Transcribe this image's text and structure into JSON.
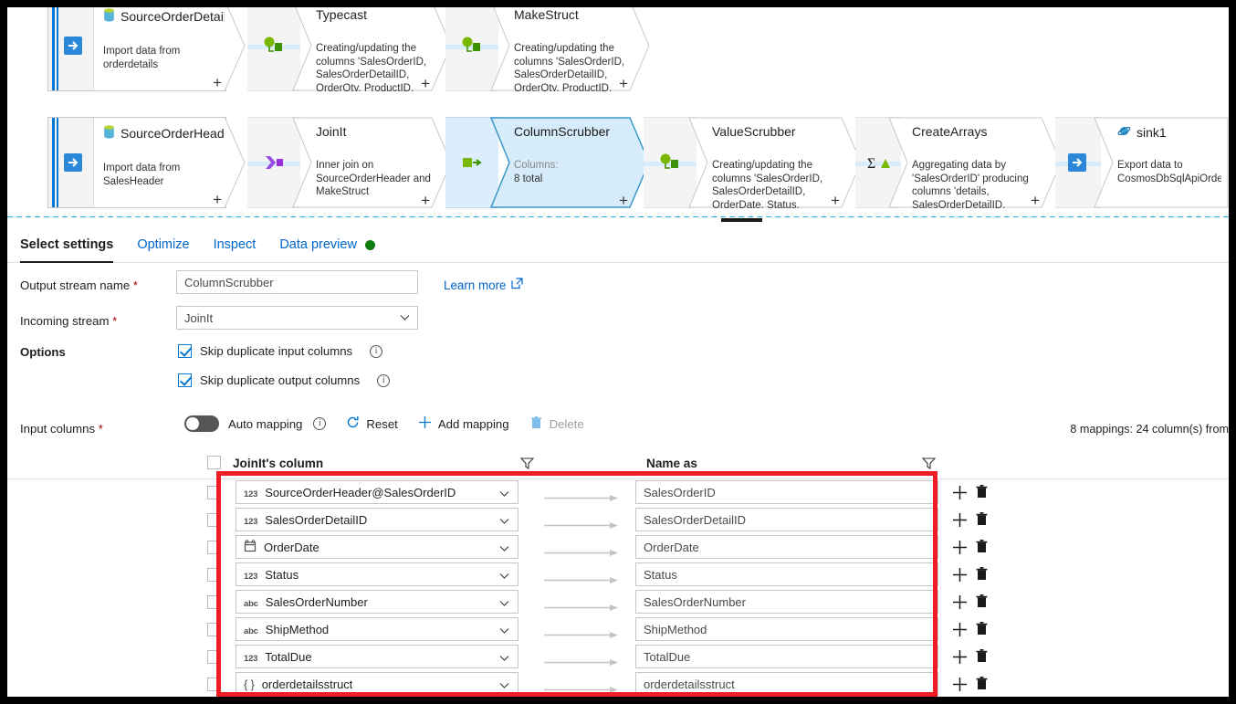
{
  "canvas": {
    "row1": [
      {
        "kind": "source",
        "icon": "sql-database-icon",
        "title": "SourceOrderDetails",
        "subtitle": "Import data from orderdetails",
        "plus": "+"
      },
      {
        "kind": "transform",
        "icon": "derived-column-icon",
        "title": "Typecast",
        "subtitle": "Creating/updating the columns 'SalesOrderID, SalesOrderDetailID, OrderQty, ProductID, UnitPrice,",
        "plus": "+"
      },
      {
        "kind": "transform",
        "icon": "derived-column-icon",
        "title": "MakeStruct",
        "subtitle": "Creating/updating the columns 'SalesOrderID, SalesOrderDetailID, OrderQty, ProductID, UnitPrice,",
        "plus": "+"
      }
    ],
    "row2": [
      {
        "kind": "source",
        "icon": "sql-database-icon",
        "title": "SourceOrderHeader",
        "subtitle": "Import data from SalesHeader",
        "plus": "+"
      },
      {
        "kind": "transform",
        "icon": "join-icon",
        "title": "JoinIt",
        "subtitle": "Inner join on SourceOrderHeader and MakeStruct",
        "plus": "+"
      },
      {
        "kind": "transform",
        "icon": "select-icon",
        "title": "ColumnScrubber",
        "subtitle_label": "Columns:",
        "subtitle": "8 total",
        "plus": "+",
        "selected": true
      },
      {
        "kind": "transform",
        "icon": "derived-column-icon",
        "title": "ValueScrubber",
        "subtitle": "Creating/updating the columns 'SalesOrderID, SalesOrderDetailID, OrderDate, Status, SalesOrderNumber,",
        "plus": "+"
      },
      {
        "kind": "transform",
        "icon": "aggregate-icon",
        "title": "CreateArrays",
        "subtitle": "Aggregating data by 'SalesOrderID' producing columns 'details, SalesOrderDetailID, OrderDate,",
        "plus": "+"
      },
      {
        "kind": "sink",
        "icon": "cosmosdb-icon",
        "title": "sink1",
        "subtitle": "Export data to CosmosDbSqlApiOrders"
      }
    ]
  },
  "tabs": [
    {
      "label": "Select settings",
      "active": true
    },
    {
      "label": "Optimize",
      "active": false
    },
    {
      "label": "Inspect",
      "active": false
    },
    {
      "label": "Data preview",
      "active": false,
      "status_dot": "#107c10"
    }
  ],
  "form": {
    "output_stream_label": "Output stream name",
    "output_stream_value": "ColumnScrubber",
    "incoming_stream_label": "Incoming stream",
    "incoming_stream_value": "JoinIt",
    "learn_more": "Learn more",
    "options_label": "Options",
    "option1": "Skip duplicate input columns",
    "option2": "Skip duplicate output columns",
    "required_marker": "*"
  },
  "toolbar": {
    "input_columns_label": "Input columns",
    "auto_mapping": "Auto mapping",
    "reset": "Reset",
    "add_mapping": "Add mapping",
    "delete": "Delete",
    "mapping_summary": "8 mappings: 24 column(s) from"
  },
  "table": {
    "col1_header": "JoinIt's column",
    "col2_header": "Name as",
    "rows": [
      {
        "type": "123",
        "source": "SourceOrderHeader@SalesOrderID",
        "target": "SalesOrderID"
      },
      {
        "type": "123",
        "source": "SalesOrderDetailID",
        "target": "SalesOrderDetailID"
      },
      {
        "type": "date",
        "source": "OrderDate",
        "target": "OrderDate"
      },
      {
        "type": "123",
        "source": "Status",
        "target": "Status"
      },
      {
        "type": "abc",
        "source": "SalesOrderNumber",
        "target": "SalesOrderNumber"
      },
      {
        "type": "abc",
        "source": "ShipMethod",
        "target": "ShipMethod"
      },
      {
        "type": "123",
        "source": "TotalDue",
        "target": "TotalDue"
      },
      {
        "type": "{ }",
        "source": "orderdetailsstruct",
        "target": "orderdetailsstruct"
      }
    ]
  },
  "colors": {
    "accent": "#0078d4",
    "link": "#0066cc",
    "selected_node": "#d6ecfa",
    "selected_border": "#3a96c8",
    "annotation_red": "#ee1c25",
    "status_green": "#107c10",
    "required_red": "#a80000"
  }
}
